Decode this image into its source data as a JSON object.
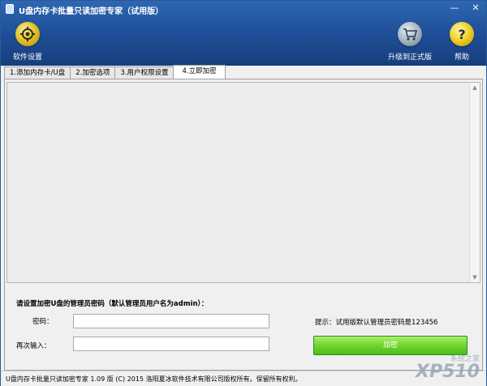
{
  "window": {
    "title": "U盘内存卡批量只读加密专家（试用版）"
  },
  "window_controls": {
    "minimize": "—",
    "close": "✕"
  },
  "toolbar": {
    "settings_label": "软件设置",
    "upgrade_label": "升级到正式版",
    "help_label": "帮助"
  },
  "tabs": [
    {
      "label": "1.添加内存卡/U盘"
    },
    {
      "label": "2.加密选项"
    },
    {
      "label": "3.用户权限设置"
    },
    {
      "label": "4.立即加密"
    }
  ],
  "form": {
    "heading": "请设置加密U盘的管理员密码（默认管理员用户名为admin）：",
    "password_label": "密码：",
    "password_value": "",
    "confirm_label": "再次输入：",
    "confirm_value": "",
    "hint": "提示：试用版默认管理员密码是123456",
    "encrypt_button": "加密"
  },
  "statusbar": {
    "text": "U盘内存卡批量只读加密专家 1.09 版 (C) 2015 洛阳夏冰软件技术有限公司版权所有。保留所有权利。"
  },
  "watermark": {
    "big": "XP510",
    "small": "系统之家"
  },
  "colors": {
    "titlebar": "#1f4f98",
    "encrypt_button": "#5cc820"
  }
}
